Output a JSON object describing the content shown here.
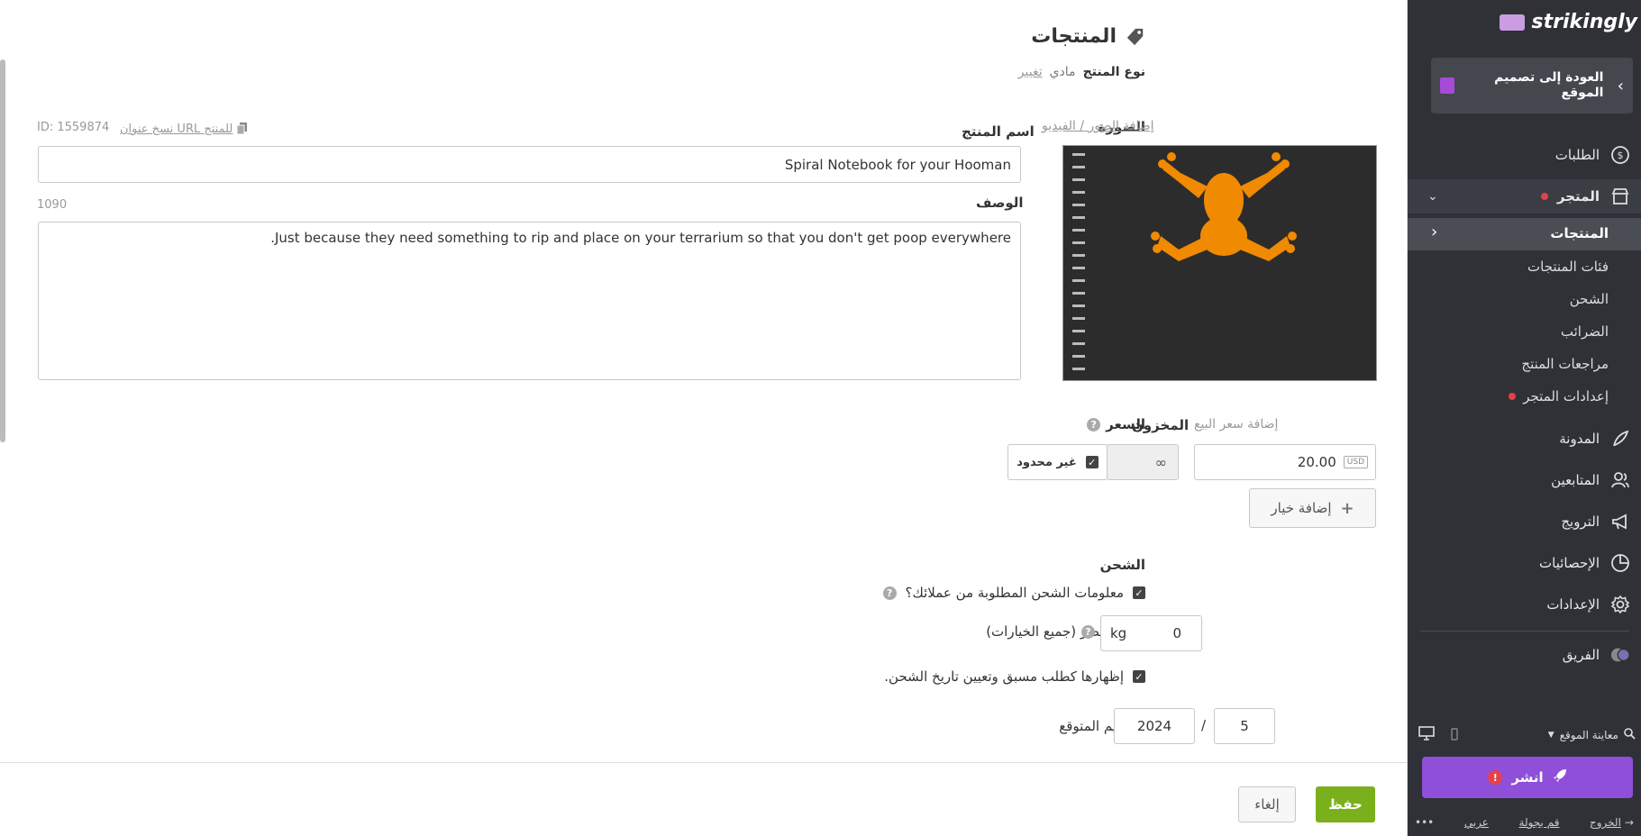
{
  "header": {
    "title": "المنتجات",
    "product_type_label": "نوع المنتج",
    "product_type_value": "مادي",
    "change_link": "تغيير"
  },
  "image_section": {
    "label": "الصورة",
    "add_link": "إضافة الصور / الفيديو"
  },
  "product": {
    "id_text": "ID: 1559874",
    "copy_url": "نسخ عنوان URL للمنتج",
    "name_label": "اسم المنتج",
    "name_value": "Spiral Notebook for your Hooman",
    "desc_label": "الوصف",
    "desc_count": "1090",
    "desc_value": "Just because they need something to rip and place on your terrarium so that you don't get poop everywhere."
  },
  "pricing": {
    "price_label": "السعر",
    "sale_link": "إضافة سعر البيع",
    "currency": "USD",
    "price_value": "20.00",
    "stock_label": "المخزون",
    "stock_value": "∞",
    "unlimited_label": "غير محدود",
    "add_option": "إضافة خيار"
  },
  "shipping": {
    "title": "الشحن",
    "info_required": "معلومات الشحن المطلوبة من عملائك؟",
    "weight_label": "وزن العنصر (جميع الخيارات)",
    "weight_value": "0",
    "weight_unit": "kg",
    "preorder": "إظهارها كطلب مسبق وتعيين تاريخ الشحن.",
    "delivery_label": "التسليم المتوقع",
    "delivery_month": "5",
    "delivery_sep": "/",
    "delivery_year": "2024"
  },
  "footer": {
    "save": "حفظ",
    "cancel": "إلغاء"
  },
  "sidebar": {
    "brand": "strikingly",
    "back": "العودة إلى تصميم الموقع",
    "orders": "الطلبات",
    "store": "المتجر",
    "sub": {
      "products": "المنتجات",
      "categories": "فئات المنتجات",
      "shipping": "الشحن",
      "taxes": "الضرائب",
      "reviews": "مراجعات المنتج",
      "settings": "إعدادات المتجر"
    },
    "blog": "المدونة",
    "followers": "المتابعين",
    "promotion": "الترويج",
    "analytics": "الإحصائيات",
    "settings": "الإعدادات",
    "team": "الفريق",
    "preview": "معاينة الموقع",
    "publish": "انشر",
    "exit": "الخروج",
    "tour": "قم بجولة",
    "language": "عربي",
    "more": "•••"
  },
  "colors": {
    "accent_green": "#7bb01d",
    "publish_purple": "#8f4fd9",
    "sidebar_bg": "#2f3136",
    "notice_red": "#e6404a",
    "frog_orange": "#f08a00"
  }
}
